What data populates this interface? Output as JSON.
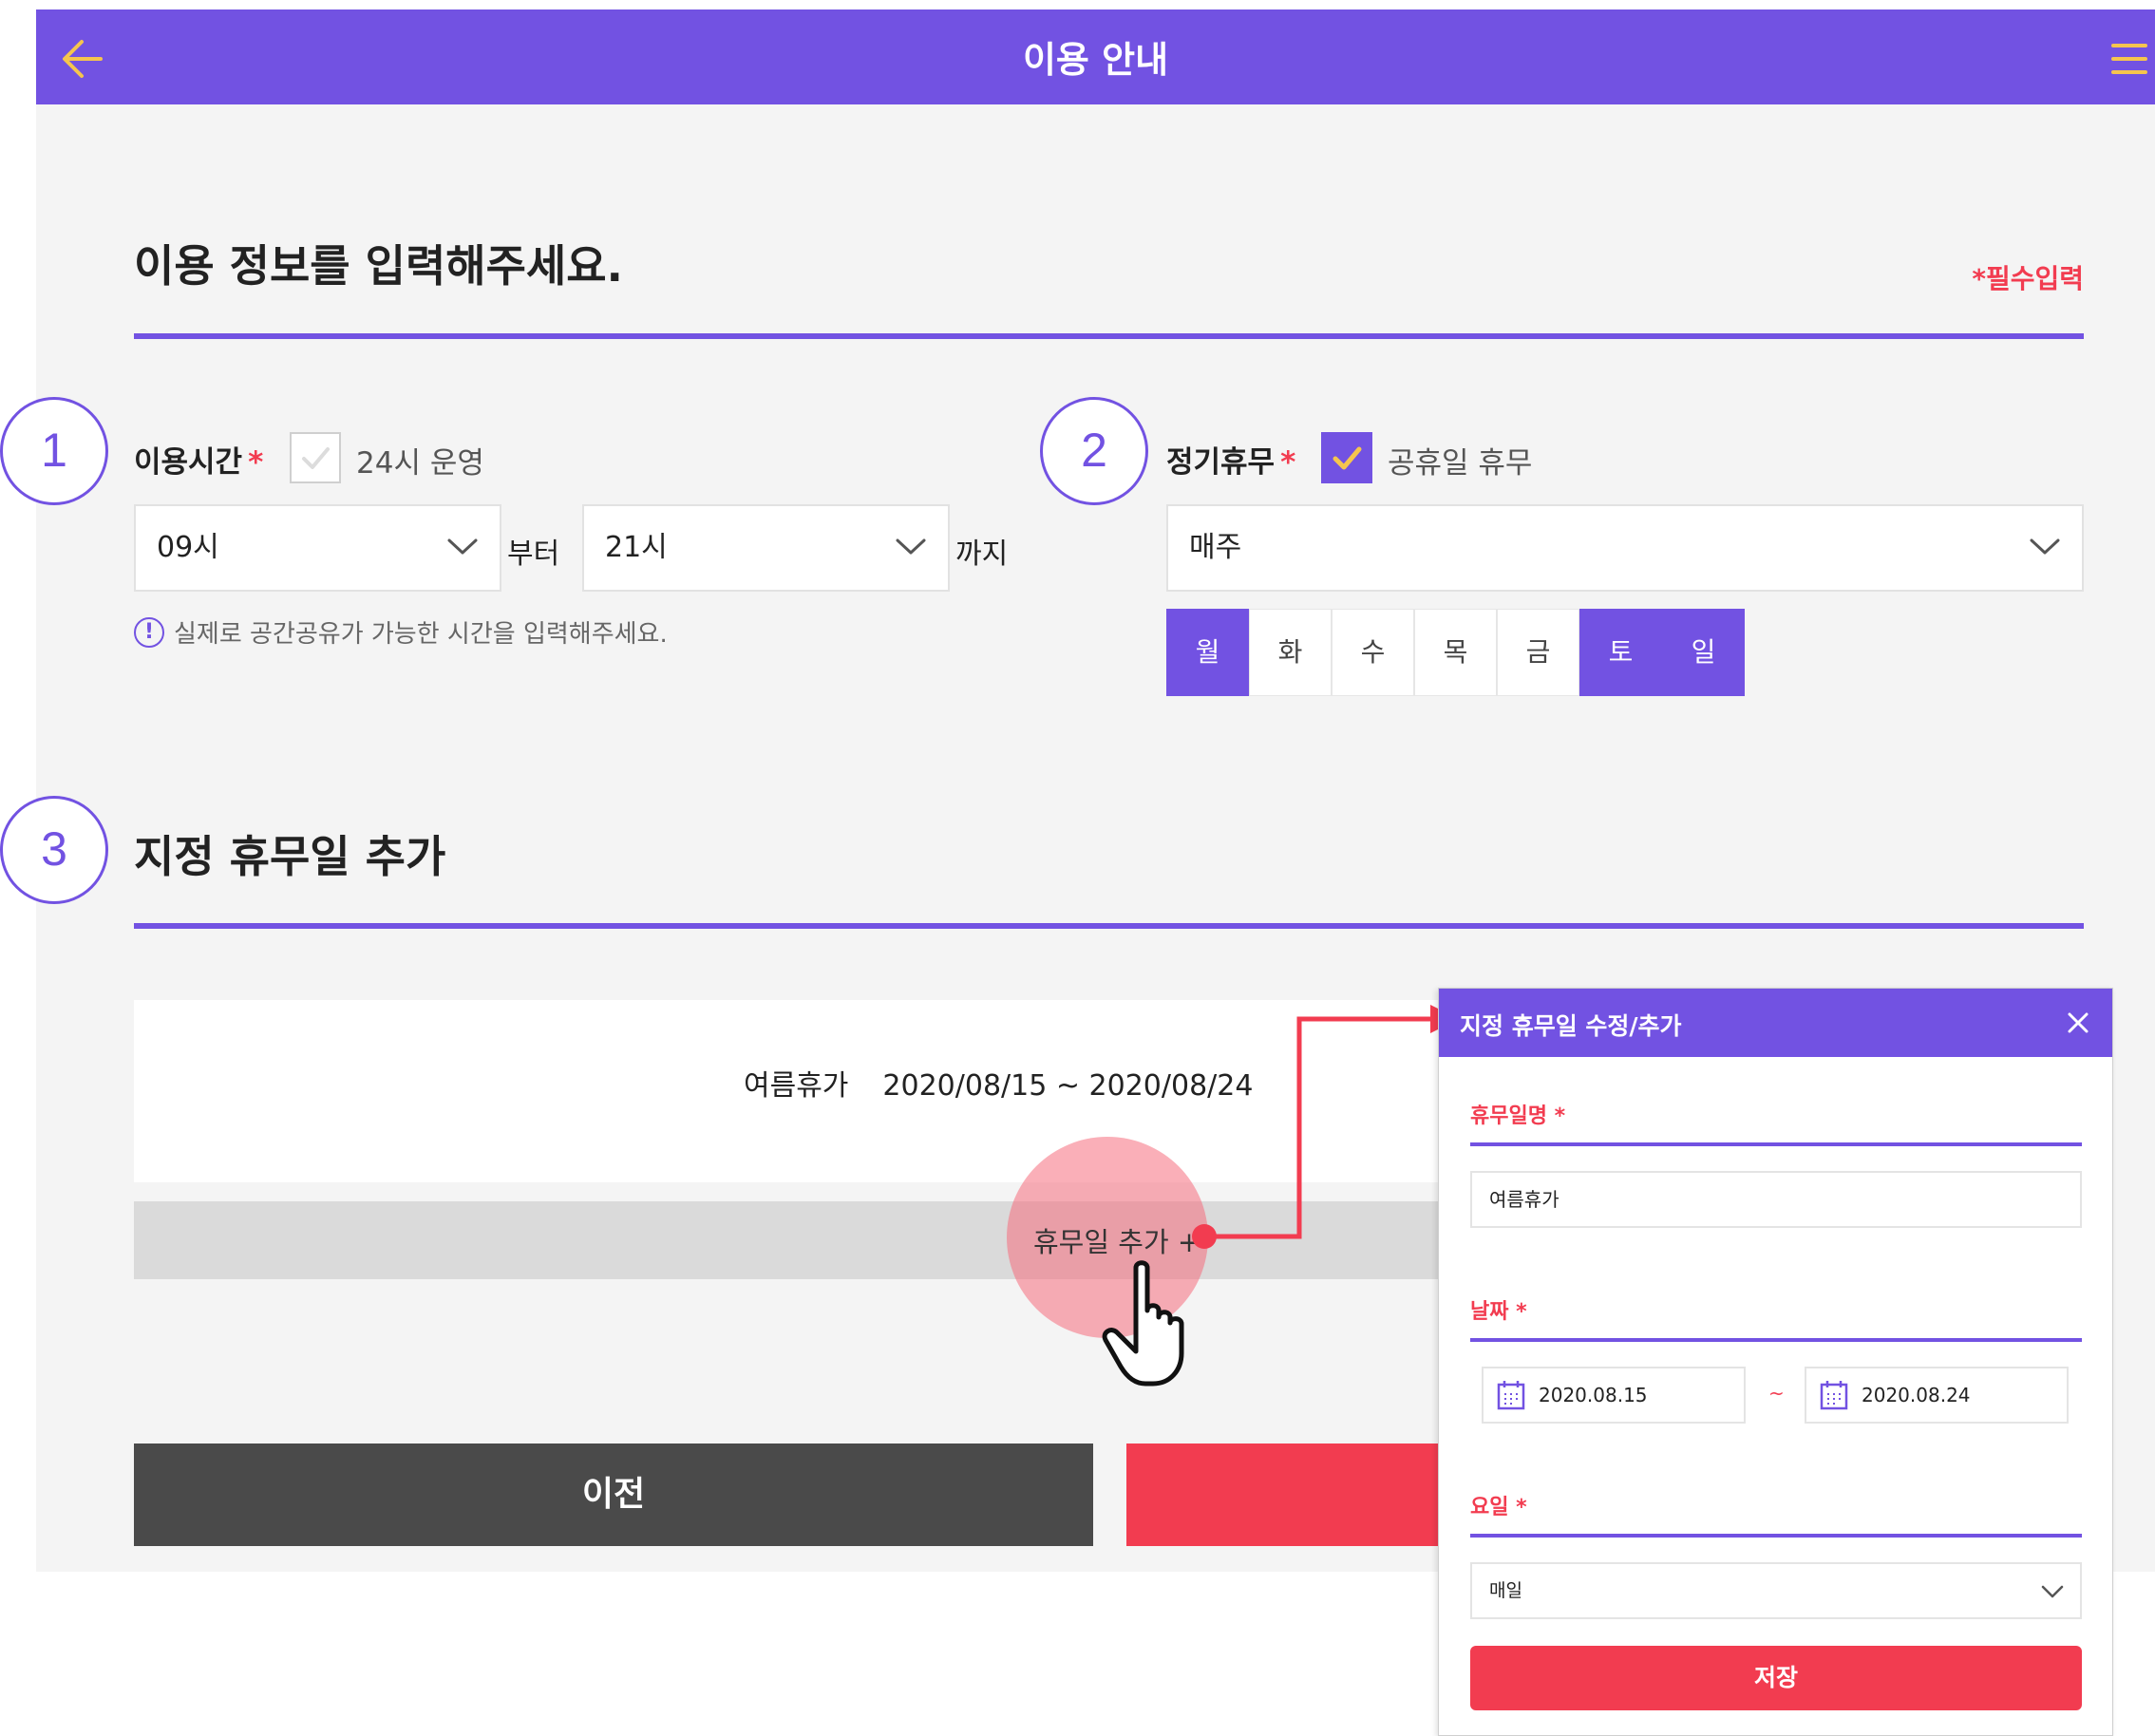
{
  "header": {
    "title": "이용 안내"
  },
  "section1": {
    "title": "이용 정보를 입력해주세요.",
    "required_note": "*필수입력"
  },
  "steps": [
    "1",
    "2",
    "3"
  ],
  "usage_time": {
    "label": "이용시간",
    "required_mark": "*",
    "checkbox_label": "24시 운영",
    "checkbox_checked": false,
    "from_value": "09시",
    "from_word": "부터",
    "to_value": "21시",
    "to_word": "까지",
    "hint": "실제로 공간공유가 가능한 시간을 입력해주세요.",
    "hint_icon": "!"
  },
  "regular_closing": {
    "label": "정기휴무",
    "required_mark": "*",
    "checkbox_label": "공휴일 휴무",
    "checkbox_checked": true,
    "frequency": "매주",
    "days": [
      {
        "label": "월",
        "selected": true
      },
      {
        "label": "화",
        "selected": false
      },
      {
        "label": "수",
        "selected": false
      },
      {
        "label": "목",
        "selected": false
      },
      {
        "label": "금",
        "selected": false
      },
      {
        "label": "토",
        "selected": true
      },
      {
        "label": "일",
        "selected": true
      }
    ]
  },
  "section3": {
    "title": "지정 휴무일 추가",
    "holiday": {
      "name": "여름휴가",
      "period": "2020/08/15 ~ 2020/08/24"
    },
    "add_button": "휴무일 추가 +"
  },
  "footer": {
    "prev_label": "이전"
  },
  "popup": {
    "title": "지정 휴무일 수정/추가",
    "name_label": "휴무일명",
    "name_value": "여름휴가",
    "date_label": "날짜",
    "date_from": "2020.08.15",
    "date_sep": "~",
    "date_to": "2020.08.24",
    "day_label": "요일",
    "day_value": "매일",
    "save_label": "저장",
    "required_mark": "*"
  },
  "colors": {
    "primary": "#7252e2",
    "accent": "#f23c50",
    "dark": "#4a4a4a"
  }
}
